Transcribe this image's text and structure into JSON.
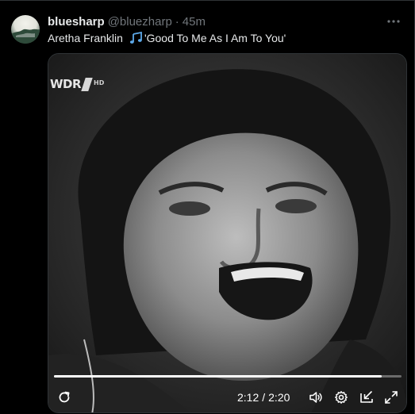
{
  "tweet": {
    "display_name": "bluesharp",
    "handle": "@bluezharp",
    "separator": "·",
    "timestamp": "45m",
    "text_before": "Aretha Franklin",
    "emoji_icon": "musical-notes-icon",
    "text_after": "'Good To Me As I Am To You'"
  },
  "video": {
    "channel_logo_text": "WDR",
    "channel_logo_badge": "HD",
    "current_time": "2:12",
    "time_separator": "/",
    "duration": "2:20",
    "progress": 0.943
  },
  "icons": {
    "more": "more-horizontal-icon",
    "replay": "replay-icon",
    "volume": "volume-icon",
    "settings": "gear-icon",
    "pip": "picture-in-picture-icon",
    "fullscreen": "fullscreen-icon"
  },
  "colors": {
    "background": "#000000",
    "text_primary": "#e7e9ea",
    "text_secondary": "#71767b",
    "border": "#2f3336",
    "emoji_blue": "#5da9e9"
  }
}
